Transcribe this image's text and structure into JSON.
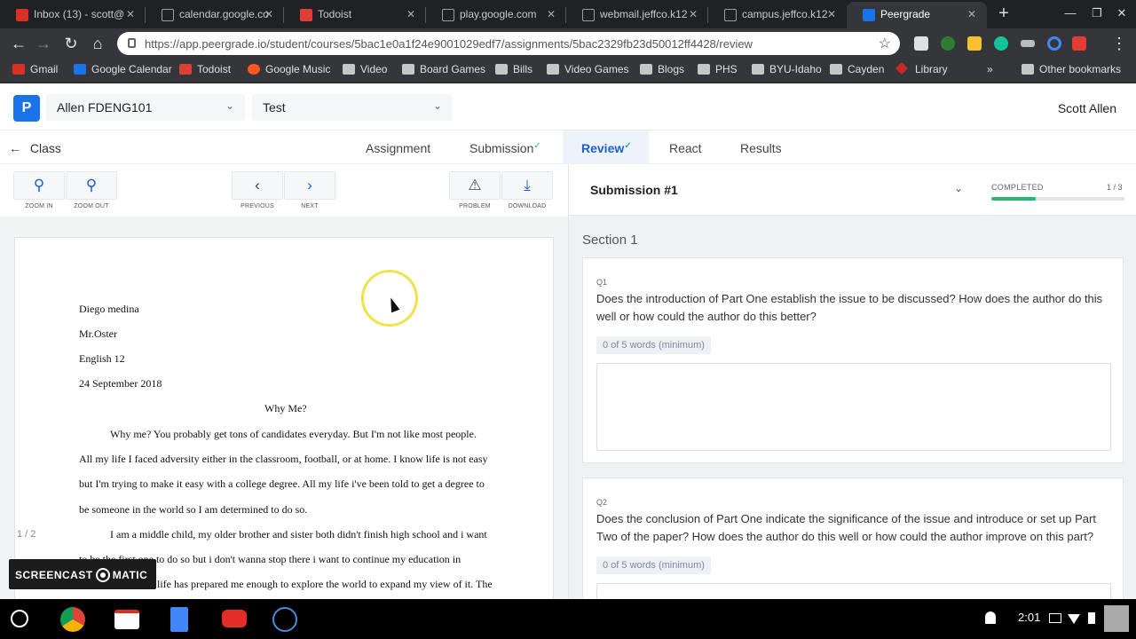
{
  "browser": {
    "tabs": [
      {
        "title": "Inbox (13) - scott@",
        "icon_color": "#d93025"
      },
      {
        "title": "calendar.google.co",
        "icon_color": "#9aa0a6"
      },
      {
        "title": "Todoist",
        "icon_color": "#db4035"
      },
      {
        "title": "play.google.com",
        "icon_color": "#9aa0a6"
      },
      {
        "title": "webmail.jeffco.k12",
        "icon_color": "#9aa0a6"
      },
      {
        "title": "campus.jeffco.k12",
        "icon_color": "#9aa0a6"
      },
      {
        "title": "Peergrade",
        "icon_color": "#1a73e8"
      }
    ],
    "url": "https://app.peergrade.io/student/courses/5bac1e0a1f24e9001029edf7/assignments/5bac2329fb23d50012ff4428/review",
    "bookmarks": [
      {
        "label": "Gmail",
        "icon_color": "#d93025"
      },
      {
        "label": "Google Calendar",
        "icon_color": "#1a73e8"
      },
      {
        "label": "Todoist",
        "icon_color": "#db4035"
      },
      {
        "label": "Google Music",
        "icon_color": "#ff5722"
      },
      {
        "label": "Video",
        "icon_color": "folder"
      },
      {
        "label": "Board Games",
        "icon_color": "folder"
      },
      {
        "label": "Bills",
        "icon_color": "folder"
      },
      {
        "label": "Video Games",
        "icon_color": "folder"
      },
      {
        "label": "Blogs",
        "icon_color": "folder"
      },
      {
        "label": "PHS",
        "icon_color": "folder"
      },
      {
        "label": "BYU-Idaho",
        "icon_color": "folder"
      },
      {
        "label": "Cayden",
        "icon_color": "folder"
      },
      {
        "label": "Library",
        "icon_color": "#c62828"
      }
    ],
    "bookmarks_more": "»",
    "other_bookmarks": "Other bookmarks"
  },
  "app": {
    "logo": "P",
    "course_select": "Allen FDENG101",
    "assignment_select": "Test",
    "user_name": "Scott Allen",
    "back_label": "Class",
    "tabs": [
      {
        "label": "Assignment",
        "check": ""
      },
      {
        "label": "Submission",
        "check": "✓"
      },
      {
        "label": "Review",
        "check": "✓"
      },
      {
        "label": "React",
        "check": ""
      },
      {
        "label": "Results",
        "check": ""
      }
    ]
  },
  "doc_toolbar": {
    "zoom_in": "ZOOM IN",
    "zoom_out": "ZOOM OUT",
    "previous": "PREVIOUS",
    "next": "NEXT",
    "problem": "PROBLEM",
    "download": "DOWNLOAD"
  },
  "document": {
    "lines": [
      "Diego medina",
      "Mr.Oster",
      "English 12",
      "24 September 2018",
      "Why Me?",
      "Why me? You probably get tons of candidates everyday. But I'm not like most people.",
      "All my life I faced adversity either in the classroom, football, or at home. I know life is not easy",
      "but I'm trying to make it easy with a college degree. All my life i've been told to get a degree to",
      "be someone in the world so I am determined to do so.",
      "I am a middle child, my older brother and sister both didn't finish high school and i want",
      "to be the first one to do so but i don't wanna stop there i want to continue my education in",
      "life has prepared me enough to explore the world to expand my view of it. The"
    ],
    "page_indicator": "1 / 2"
  },
  "review": {
    "submission_select": "Submission #1",
    "completed_label": "COMPLETED",
    "completed_count": "1 / 3",
    "completed_fraction": 0.333,
    "section_title": "Section 1",
    "questions": [
      {
        "num": "Q1",
        "text": "Does the introduction of Part One establish the issue to be discussed? How does the author do this well or how could the author do this better?",
        "word_count": "0 of 5 words (minimum)"
      },
      {
        "num": "Q2",
        "text": "Does the conclusion of Part One indicate the significance of the issue and introduce or set up Part Two of the paper? How does the author do this well or how could the author improve on this part?",
        "word_count": "0 of 5 words (minimum)"
      }
    ]
  },
  "overlay": {
    "watermark_left": "SCREENCAST",
    "watermark_right": "MATIC"
  },
  "shelf": {
    "time": "2:01"
  }
}
